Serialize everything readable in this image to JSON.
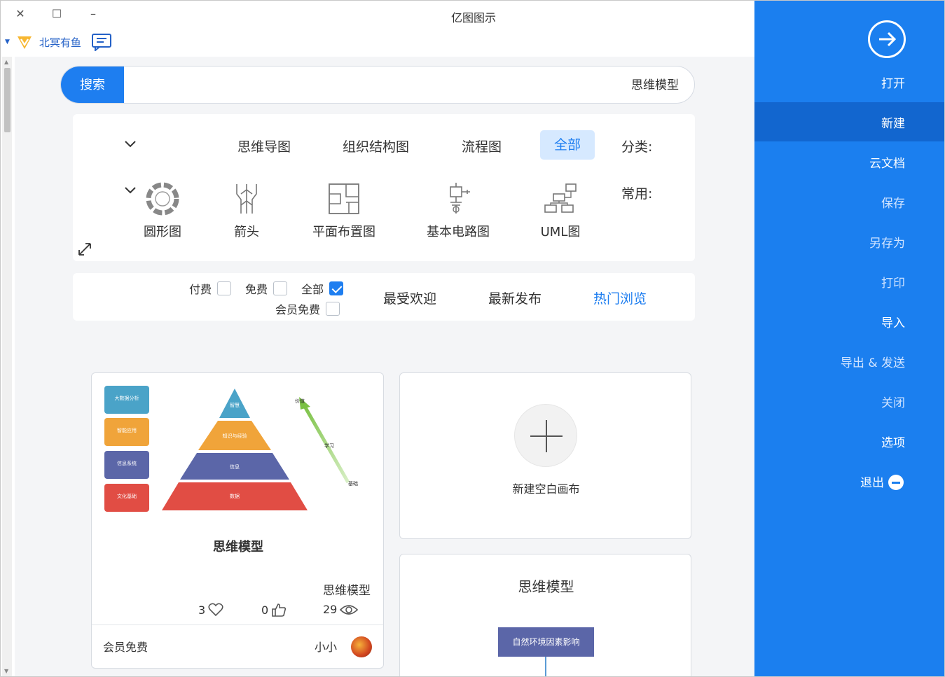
{
  "window": {
    "title": "亿图图示",
    "controls": {
      "close": "✕",
      "maximize": "☐",
      "minimize": "–"
    }
  },
  "user": {
    "name": "北冥有鱼"
  },
  "search": {
    "button": "搜索",
    "value": "思维模型"
  },
  "categories": {
    "label": "分类:",
    "items": [
      "全部",
      "流程图",
      "组织结构图",
      "思维导图"
    ],
    "active": "全部"
  },
  "common": {
    "label": "常用:",
    "templates": [
      {
        "label": "UML图",
        "icon": "uml-icon"
      },
      {
        "label": "基本电路图",
        "icon": "circuit-icon"
      },
      {
        "label": "平面布置图",
        "icon": "floorplan-icon"
      },
      {
        "label": "箭头",
        "icon": "arrow-icon"
      },
      {
        "label": "圆形图",
        "icon": "circle-diagram-icon"
      }
    ]
  },
  "filter": {
    "sort": [
      "热门浏览",
      "最新发布",
      "最受欢迎"
    ],
    "active_sort": "热门浏览",
    "checkboxes": [
      {
        "label": "全部",
        "checked": true
      },
      {
        "label": "免费",
        "checked": false
      },
      {
        "label": "付费",
        "checked": false
      },
      {
        "label": "会员免费",
        "checked": false
      }
    ]
  },
  "cards": {
    "blank": {
      "label": "新建空白画布"
    },
    "template": {
      "preview_title": "思维模型",
      "name": "思维模型",
      "views": "29",
      "likes": "0",
      "favorites": "3",
      "author": "小小",
      "price": "会员免费",
      "pyramid_levels": [
        "智慧",
        "知识与经验",
        "信息",
        "数据"
      ],
      "side_boxes": [
        "大数据分析",
        "智能应用",
        "信息系统",
        "文化基础"
      ],
      "side_box_colors": [
        "#4aa3c8",
        "#f0a43a",
        "#5b66a8",
        "#e14d44"
      ],
      "arrow_labels": [
        "价值",
        "学习",
        "基础"
      ]
    },
    "third": {
      "title": "思维模型",
      "box": "自然环境因素影响"
    }
  },
  "sidebar": {
    "open": "打开",
    "items": [
      "新建",
      "云文档",
      "保存",
      "另存为",
      "打印",
      "导入",
      "导出 & 发送",
      "关闭",
      "选项"
    ],
    "active": "新建",
    "exit": "退出",
    "color": "#1b7fef"
  }
}
